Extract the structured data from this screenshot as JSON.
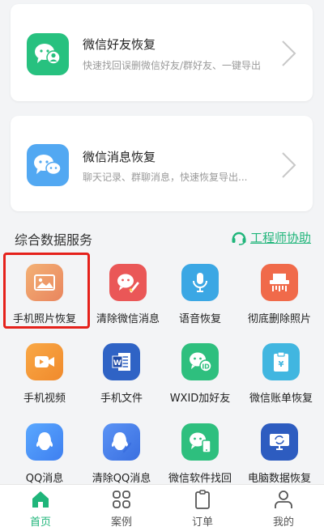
{
  "cards": [
    {
      "title": "微信好友恢复",
      "subtitle": "快速找回误删微信好友/群好友、一键导出",
      "icon": "wechat-contacts-icon"
    },
    {
      "title": "微信消息恢复",
      "subtitle": "聊天记录、群聊消息，快速恢复导出...",
      "icon": "wechat-messages-icon"
    }
  ],
  "section": {
    "title": "综合数据服务",
    "help_label": "工程师协助"
  },
  "services": [
    {
      "label": "手机照片恢复",
      "icon": "photo-icon",
      "color": "#f0a06b"
    },
    {
      "label": "清除微信消息",
      "icon": "clean-wechat-icon",
      "color": "#ea5757"
    },
    {
      "label": "语音恢复",
      "icon": "microphone-icon",
      "color": "#3ba7e4"
    },
    {
      "label": "彻底删除照片",
      "icon": "shredder-icon",
      "color": "#f06a4a"
    },
    {
      "label": "手机视频",
      "icon": "video-icon",
      "color": "#f59a3b"
    },
    {
      "label": "手机文件",
      "icon": "word-file-icon",
      "color": "#2f63c5"
    },
    {
      "label": "WXID加好友",
      "icon": "wxid-icon",
      "color": "#2ebf7e"
    },
    {
      "label": "微信账单恢复",
      "icon": "bill-icon",
      "color": "#41b6e0"
    },
    {
      "label": "QQ消息",
      "icon": "qq-icon",
      "color": "#3e8ff5"
    },
    {
      "label": "清除QQ消息",
      "icon": "clean-qq-icon",
      "color": "#4b82e8"
    },
    {
      "label": "微信软件找回",
      "icon": "wechat-app-icon",
      "color": "#2ebf7e"
    },
    {
      "label": "电脑数据恢复",
      "icon": "computer-icon",
      "color": "#2d5cc0"
    }
  ],
  "tabs": [
    {
      "label": "首页",
      "icon": "home-icon",
      "active": true
    },
    {
      "label": "案例",
      "icon": "grid-icon",
      "active": false
    },
    {
      "label": "订单",
      "icon": "clipboard-icon",
      "active": false
    },
    {
      "label": "我的",
      "icon": "user-icon",
      "active": false
    }
  ],
  "colors": {
    "accent": "#1fb57a",
    "highlight": "#e5211b"
  }
}
